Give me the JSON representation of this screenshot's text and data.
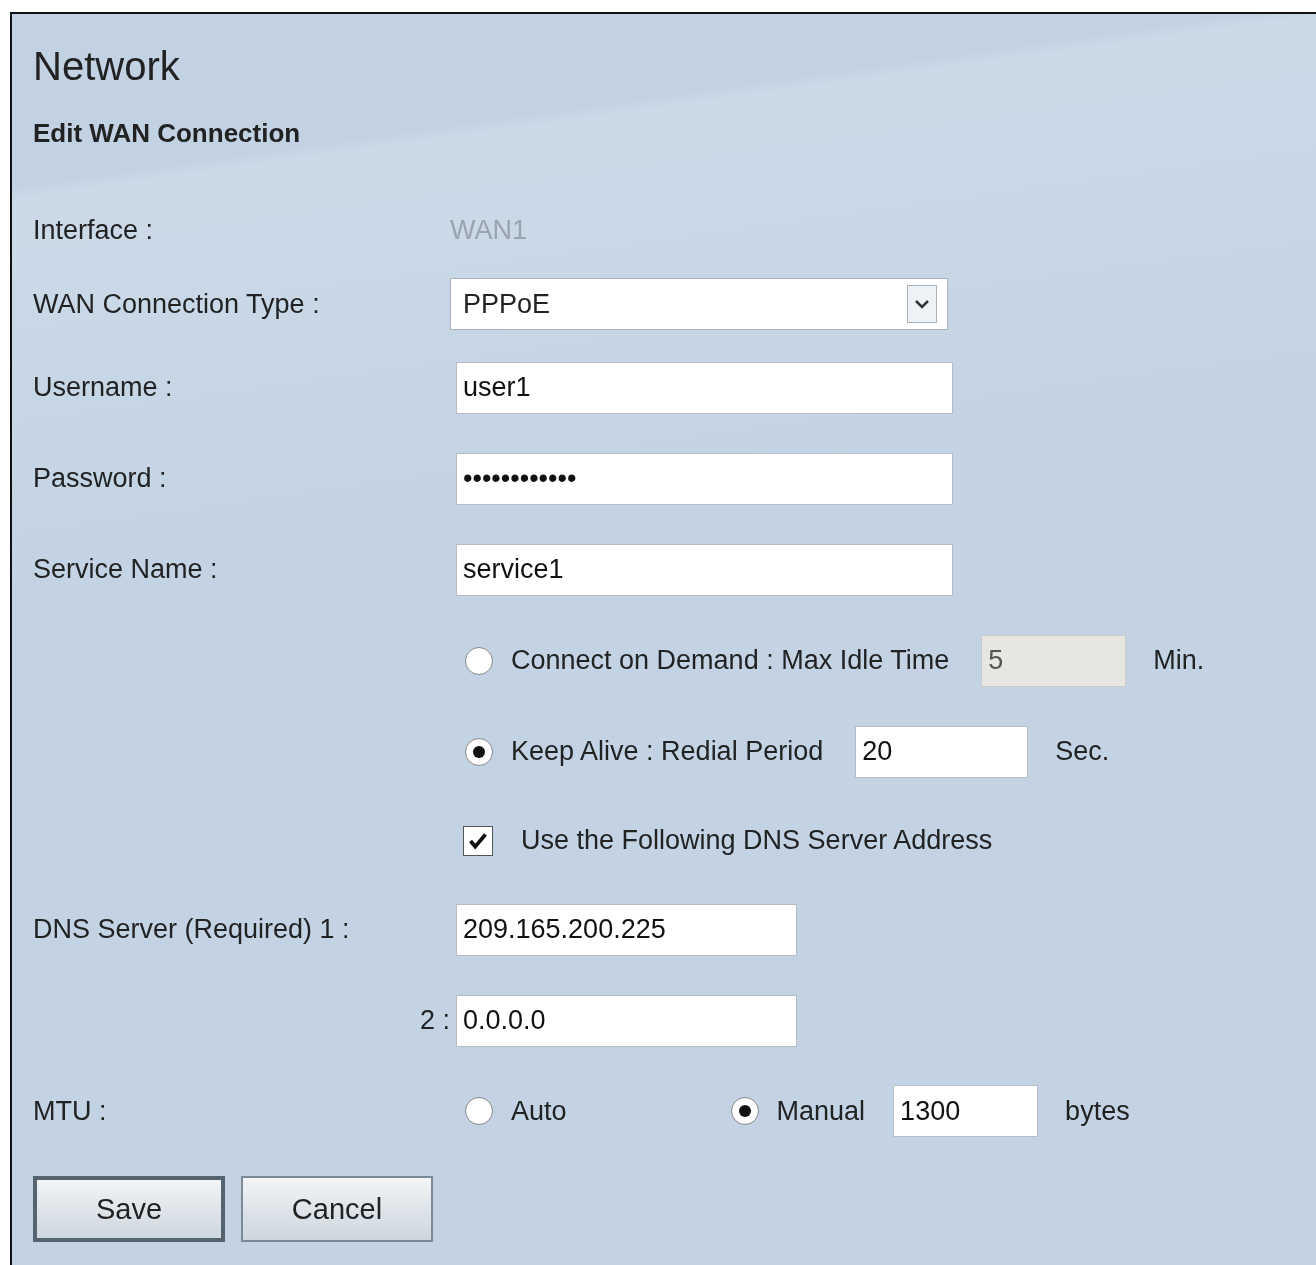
{
  "page": {
    "title": "Network",
    "subtitle": "Edit WAN Connection"
  },
  "interface": {
    "label": "Interface :",
    "value": "WAN1"
  },
  "connection_type": {
    "label": "WAN Connection Type :",
    "value": "PPPoE"
  },
  "username": {
    "label": "Username :",
    "value": "user1"
  },
  "password": {
    "label": "Password :",
    "value": "••••••••••••"
  },
  "service_name": {
    "label": "Service Name :",
    "value": "service1"
  },
  "connection_modes": [
    {
      "label": "Connect on Demand : Max Idle Time",
      "value": "5",
      "unit": "Min.",
      "selected": false,
      "disabled": true
    },
    {
      "label": "Keep Alive : Redial Period",
      "value": "20",
      "unit": "Sec.",
      "selected": true,
      "disabled": false
    }
  ],
  "use_dns": {
    "label": "Use the Following DNS Server Address",
    "checked": true
  },
  "dns_servers": [
    {
      "label": "DNS Server (Required) 1 :",
      "value": "209.165.200.225"
    },
    {
      "label": "2 :",
      "value": "0.0.0.0"
    }
  ],
  "mtu": {
    "label": "MTU :",
    "options": [
      {
        "label": "Auto",
        "selected": false
      },
      {
        "label": "Manual",
        "selected": true
      }
    ],
    "value": "1300",
    "unit": "bytes"
  },
  "buttons": [
    {
      "label": "Save",
      "default": true
    },
    {
      "label": "Cancel",
      "default": false
    }
  ]
}
